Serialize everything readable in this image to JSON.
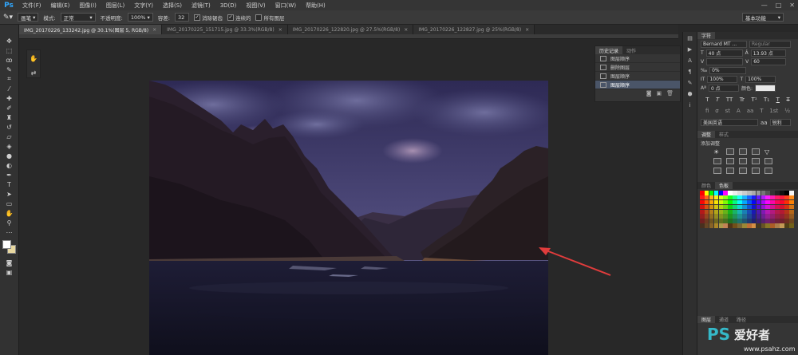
{
  "app": {
    "logo": "Ps"
  },
  "menu": [
    "文件(F)",
    "编辑(E)",
    "图像(I)",
    "图层(L)",
    "文字(Y)",
    "选择(S)",
    "滤镜(T)",
    "3D(D)",
    "视图(V)",
    "窗口(W)",
    "帮助(H)"
  ],
  "window_controls": [
    "—",
    "□",
    "✕"
  ],
  "options": {
    "mode_select": "画笔",
    "mode_label": "模式:",
    "mode_value": "正常",
    "opacity_label": "不透明度:",
    "opacity_value": "100%",
    "tolerance_label": "容差:",
    "tolerance_value": "32",
    "antialias_label": "消除锯齿",
    "contiguous_label": "连续的",
    "all_layers_label": "所有图层",
    "workspace": "基本功能"
  },
  "tabs": [
    {
      "label": "IMG_20170226_133242.jpg @ 30.1%(图层 5, RGB/8)"
    },
    {
      "label": "IMG_20170225_151715.jpg @ 33.3%(RGB/8)"
    },
    {
      "label": "IMG_20170226_122820.jpg @ 27.5%(RGB/8)"
    },
    {
      "label": "IMG_20170226_122827.jpg @ 25%(RGB/8)"
    }
  ],
  "history_panel": {
    "tabs": [
      "历史记录",
      "动作"
    ],
    "items": [
      "图层顺序",
      "删除图层",
      "图层顺序",
      "图层顺序"
    ],
    "active_index": 3
  },
  "character_panel": {
    "title": "字符",
    "font_family": "Bernard MT ...",
    "font_style": "Regular",
    "font_size": "40 点",
    "leading": "13.93 点",
    "kerning": "",
    "tracking": "60",
    "scale_pct": "0%",
    "vscale": "100%",
    "hscale": "100%",
    "baseline": "0 点",
    "color_label": "颜色:",
    "lang": "美国英语",
    "aa": "aa",
    "aa_mode": "锐利",
    "style_buttons": [
      "T",
      "T",
      "TT",
      "Tr",
      "T¹",
      "T₁",
      "T",
      "T"
    ]
  },
  "adjust_panel": {
    "tabs": [
      "调整",
      "样式"
    ],
    "subtitle": "添加调整"
  },
  "swatch_panel": {
    "tabs": [
      "颜色",
      "色板"
    ]
  },
  "layers_panel": {
    "tabs": [
      "图层",
      "通道",
      "路径"
    ]
  },
  "watermark": {
    "brand": "PS",
    "text": "爱好者",
    "url": "www.psahz.com"
  },
  "colors": {
    "accent": "#31a8ff",
    "arrow": "#e03c3c",
    "history_active": "#4a5568"
  }
}
